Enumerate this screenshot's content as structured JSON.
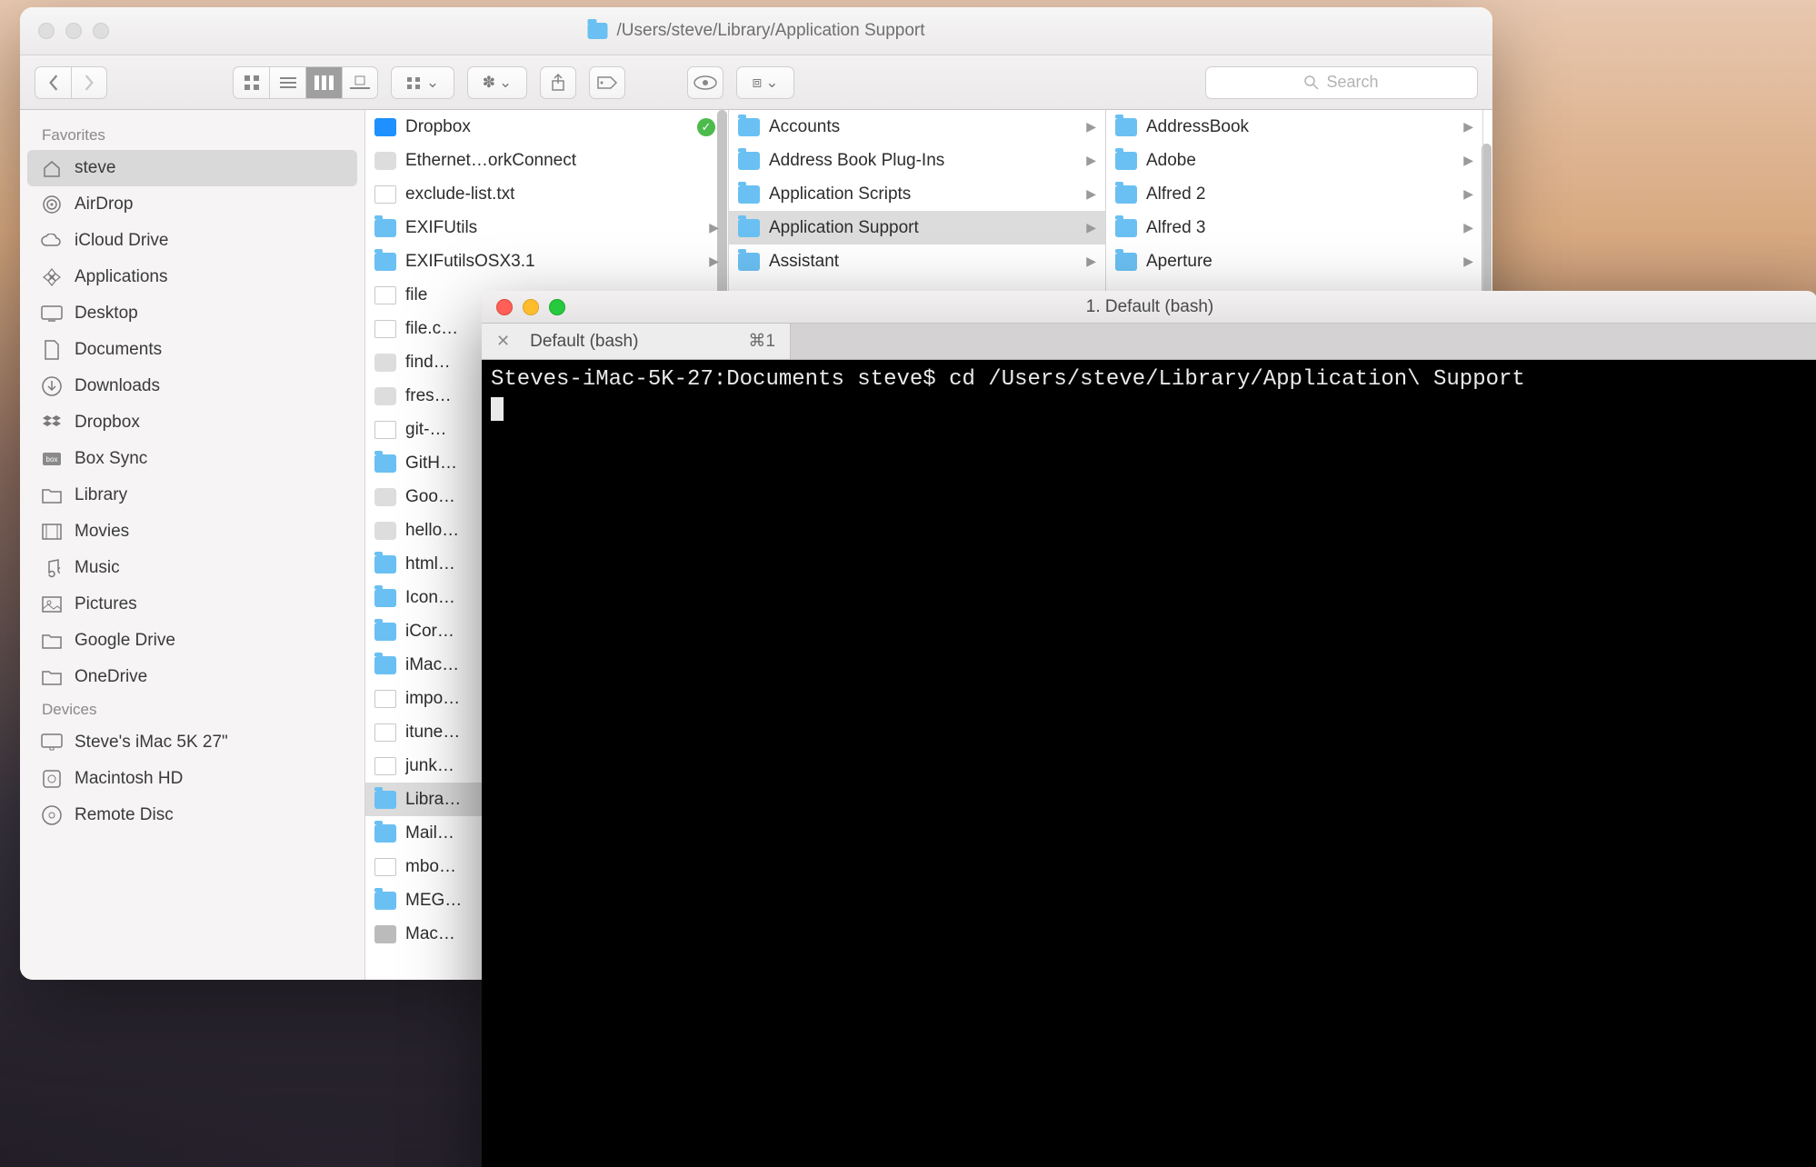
{
  "finder": {
    "window_path": "/Users/steve/Library/Application Support",
    "search_placeholder": "Search",
    "sidebar": {
      "sections": [
        {
          "title": "Favorites",
          "items": [
            {
              "label": "steve",
              "icon": "home",
              "selected": true
            },
            {
              "label": "AirDrop",
              "icon": "airdrop"
            },
            {
              "label": "iCloud Drive",
              "icon": "cloud"
            },
            {
              "label": "Applications",
              "icon": "apps"
            },
            {
              "label": "Desktop",
              "icon": "desktop"
            },
            {
              "label": "Documents",
              "icon": "documents"
            },
            {
              "label": "Downloads",
              "icon": "downloads"
            },
            {
              "label": "Dropbox",
              "icon": "dropbox"
            },
            {
              "label": "Box Sync",
              "icon": "box"
            },
            {
              "label": "Library",
              "icon": "folder"
            },
            {
              "label": "Movies",
              "icon": "movies"
            },
            {
              "label": "Music",
              "icon": "music"
            },
            {
              "label": "Pictures",
              "icon": "pictures"
            },
            {
              "label": "Google Drive",
              "icon": "folder"
            },
            {
              "label": "OneDrive",
              "icon": "folder"
            }
          ]
        },
        {
          "title": "Devices",
          "items": [
            {
              "label": "Steve's iMac 5K 27\"",
              "icon": "imac"
            },
            {
              "label": "Macintosh HD",
              "icon": "disk"
            },
            {
              "label": "Remote Disc",
              "icon": "disc"
            }
          ]
        }
      ]
    },
    "columns": [
      {
        "items": [
          {
            "label": "Dropbox",
            "type": "folder",
            "badge": "✓",
            "icon": "dropbox-blue"
          },
          {
            "label": "Ethernet…orkConnect",
            "type": "app"
          },
          {
            "label": "exclude-list.txt",
            "type": "file"
          },
          {
            "label": "EXIFUtils",
            "type": "folder",
            "has_children": true
          },
          {
            "label": "EXIFutilsOSX3.1",
            "type": "folder",
            "has_children": true
          },
          {
            "label": "file",
            "type": "file"
          },
          {
            "label": "file.c…",
            "type": "xls"
          },
          {
            "label": "find…",
            "type": "app"
          },
          {
            "label": "fres…",
            "type": "app"
          },
          {
            "label": "git-…",
            "type": "term"
          },
          {
            "label": "GitH…",
            "type": "folder"
          },
          {
            "label": "Goo…",
            "type": "app"
          },
          {
            "label": "hello…",
            "type": "app"
          },
          {
            "label": "html…",
            "type": "folder"
          },
          {
            "label": "Icon…",
            "type": "folder"
          },
          {
            "label": "iCor…",
            "type": "folder"
          },
          {
            "label": "iMac…",
            "type": "folder"
          },
          {
            "label": "impo…",
            "type": "file"
          },
          {
            "label": "itune…",
            "type": "file"
          },
          {
            "label": "junk…",
            "type": "file"
          },
          {
            "label": "Libra…",
            "type": "library",
            "selected": true
          },
          {
            "label": "Mail…",
            "type": "folder"
          },
          {
            "label": "mbo…",
            "type": "file"
          },
          {
            "label": "MEG…",
            "type": "folder"
          },
          {
            "label": "Mac…",
            "type": "disk"
          }
        ]
      },
      {
        "items": [
          {
            "label": "Accounts",
            "type": "folder",
            "has_children": true
          },
          {
            "label": "Address Book Plug-Ins",
            "type": "folder",
            "has_children": true
          },
          {
            "label": "Application Scripts",
            "type": "folder",
            "has_children": true
          },
          {
            "label": "Application Support",
            "type": "folder",
            "has_children": true,
            "selected": true
          },
          {
            "label": "Assistant",
            "type": "folder",
            "has_children": true
          }
        ]
      },
      {
        "items": [
          {
            "label": "AddressBook",
            "type": "folder",
            "has_children": true
          },
          {
            "label": "Adobe",
            "type": "folder",
            "has_children": true
          },
          {
            "label": "Alfred 2",
            "type": "folder",
            "has_children": true
          },
          {
            "label": "Alfred 3",
            "type": "folder",
            "has_children": true
          },
          {
            "label": "Aperture",
            "type": "folder",
            "has_children": true
          }
        ]
      }
    ]
  },
  "terminal": {
    "title": "1. Default (bash)",
    "tab": {
      "label": "Default (bash)",
      "shortcut": "⌘1"
    },
    "prompt": "Steves-iMac-5K-27:Documents steve$ ",
    "command": "cd /Users/steve/Library/Application\\ Support"
  }
}
